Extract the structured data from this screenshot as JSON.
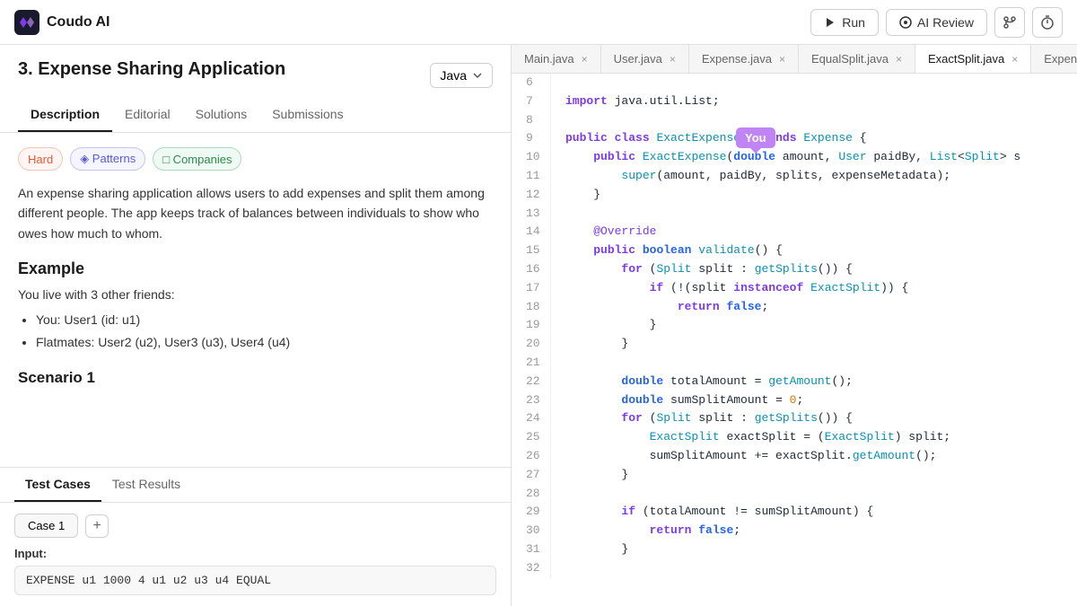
{
  "app": {
    "logo_text": "Coudo AI",
    "run_label": "Run",
    "ai_review_label": "AI Review"
  },
  "problem": {
    "title": "3. Expense Sharing Application",
    "language": "Java",
    "tabs": [
      "Description",
      "Editorial",
      "Solutions",
      "Submissions"
    ],
    "active_tab": "Description",
    "tags": [
      {
        "label": "Hard",
        "type": "hard"
      },
      {
        "label": "Patterns",
        "type": "patterns",
        "icon": "◈"
      },
      {
        "label": "Companies",
        "type": "companies",
        "icon": "□"
      }
    ],
    "description": "An expense sharing application allows users to add expenses and split them among different people. The app keeps track of balances between individuals to show who owes how much to whom.",
    "example_heading": "Example",
    "example_intro": "You live with 3 other friends:",
    "bullets": [
      "You: User1 (id: u1)",
      "Flatmates: User2 (u2), User3 (u3), User4 (u4)"
    ],
    "scenario_heading": "Scenario 1"
  },
  "test_panel": {
    "tabs": [
      "Test Cases",
      "Test Results"
    ],
    "active_tab": "Test Cases",
    "cases": [
      {
        "label": "Case 1"
      }
    ],
    "add_label": "+",
    "input_label": "Input:",
    "input_value": "EXPENSE u1 1000 4 u1 u2 u3 u4 EQUAL"
  },
  "editor": {
    "file_tabs": [
      {
        "name": "Main.java",
        "active": false
      },
      {
        "name": "User.java",
        "active": false
      },
      {
        "name": "Expense.java",
        "active": false
      },
      {
        "name": "EqualSplit.java",
        "active": false
      },
      {
        "name": "ExactSplit.java",
        "active": true
      },
      {
        "name": "ExpenseMetadata.java",
        "active": false
      }
    ],
    "you_popup": "You",
    "lines": [
      {
        "num": 6,
        "tokens": []
      },
      {
        "num": 7,
        "text": "import java.util.List;"
      },
      {
        "num": 8,
        "tokens": []
      },
      {
        "num": 9,
        "text": "public class ExactExpense extends Expense {"
      },
      {
        "num": 10,
        "text": "    public ExactExpense(double amount, User paidBy, List<Split> s"
      },
      {
        "num": 11,
        "text": "        super(amount, paidBy, splits, expenseMetadata);"
      },
      {
        "num": 12,
        "text": "    }"
      },
      {
        "num": 13,
        "tokens": []
      },
      {
        "num": 14,
        "text": "    @Override"
      },
      {
        "num": 15,
        "text": "    public boolean validate() {"
      },
      {
        "num": 16,
        "text": "        for (Split split : getSplits()) {"
      },
      {
        "num": 17,
        "text": "            if (!(split instanceof ExactSplit)) {"
      },
      {
        "num": 18,
        "text": "                return false;"
      },
      {
        "num": 19,
        "text": "            }"
      },
      {
        "num": 20,
        "text": "        }"
      },
      {
        "num": 21,
        "tokens": []
      },
      {
        "num": 22,
        "text": "        double totalAmount = getAmount();"
      },
      {
        "num": 23,
        "text": "        double sumSplitAmount = 0;"
      },
      {
        "num": 24,
        "text": "        for (Split split : getSplits()) {"
      },
      {
        "num": 25,
        "text": "            ExactSplit exactSplit = (ExactSplit) split;"
      },
      {
        "num": 26,
        "text": "            sumSplitAmount += exactSplit.getAmount();"
      },
      {
        "num": 27,
        "text": "        }"
      },
      {
        "num": 28,
        "tokens": []
      },
      {
        "num": 29,
        "text": "        if (totalAmount != sumSplitAmount) {"
      },
      {
        "num": 30,
        "text": "            return false;"
      },
      {
        "num": 31,
        "text": "        }"
      },
      {
        "num": 32,
        "tokens": []
      }
    ]
  }
}
